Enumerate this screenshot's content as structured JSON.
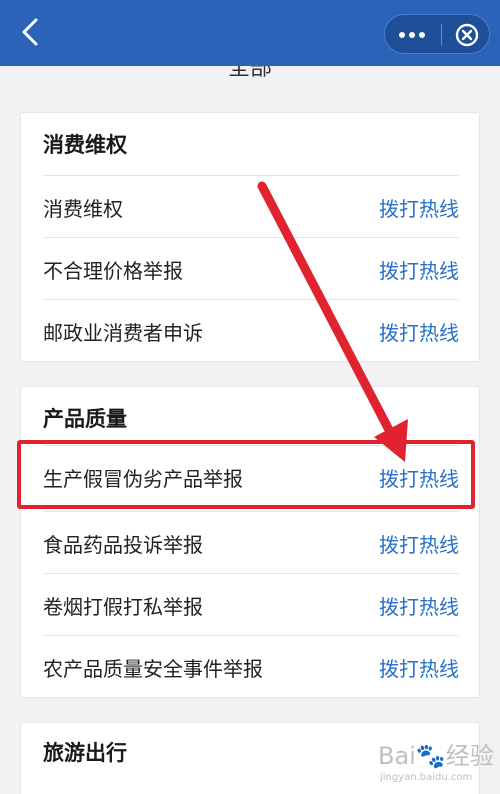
{
  "nav": {
    "back_icon": "chevron-left-icon",
    "more_icon": "more-dots-icon",
    "close_icon": "circle-close-icon",
    "background": "#2a63b8"
  },
  "peek_text": "全部",
  "sections": [
    {
      "title": "消费维权",
      "items": [
        {
          "label": "消费维权",
          "action": "拨打热线"
        },
        {
          "label": "不合理价格举报",
          "action": "拨打热线"
        },
        {
          "label": "邮政业消费者申诉",
          "action": "拨打热线"
        }
      ]
    },
    {
      "title": "产品质量",
      "items": [
        {
          "label": "生产假冒伪劣产品举报",
          "action": "拨打热线"
        },
        {
          "label": "食品药品投诉举报",
          "action": "拨打热线"
        },
        {
          "label": "卷烟打假打私举报",
          "action": "拨打热线"
        },
        {
          "label": "农产品质量安全事件举报",
          "action": "拨打热线"
        }
      ]
    },
    {
      "title": "旅游出行",
      "items": []
    }
  ],
  "annotation": {
    "color": "#e0232e"
  },
  "colors": {
    "accent": "#2a6fc9"
  },
  "watermark": {
    "logo": "Bai🐾经验",
    "sub": "jingyan.baidu.com"
  }
}
